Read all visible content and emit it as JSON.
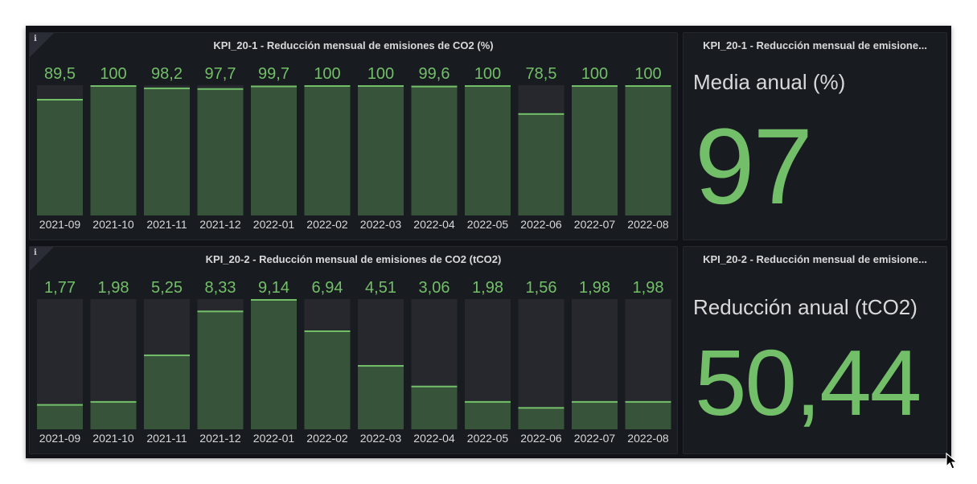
{
  "colors": {
    "accent_green": "#73bf69",
    "bar_fill": "#37543a",
    "bar_track": "#26282e",
    "panel_bg": "#181b1f",
    "dashboard_bg": "#111217",
    "text": "#d8d9da"
  },
  "panels": {
    "kpi1_bars": {
      "title": "KPI_20-1 - Reducción mensual de emisiones de CO2 (%)",
      "info_icon": "info-icon"
    },
    "kpi1_stat": {
      "title": "KPI_20-1 - Reducción mensual de emisione...",
      "label": "Media anual (%)",
      "value": "97"
    },
    "kpi2_bars": {
      "title": "KPI_20-2 - Reducción mensual de emisiones de CO2 (tCO2)",
      "info_icon": "info-icon"
    },
    "kpi2_stat": {
      "title": "KPI_20-2 - Reducción mensual de emisione...",
      "label": "Reducción anual (tCO2)",
      "value": "50,44"
    }
  },
  "chart_data": [
    {
      "type": "bar",
      "categories": [
        "2021-09",
        "2021-10",
        "2021-11",
        "2021-12",
        "2022-01",
        "2022-02",
        "2022-03",
        "2022-04",
        "2022-05",
        "2022-06",
        "2022-07",
        "2022-08"
      ],
      "values": [
        89.5,
        100,
        98.2,
        97.7,
        99.7,
        100,
        100,
        99.6,
        100,
        78.5,
        100,
        100
      ],
      "value_labels": [
        "89,5",
        "100",
        "98,2",
        "97,7",
        "99,7",
        "100",
        "100",
        "99,6",
        "100",
        "78,5",
        "100",
        "100"
      ],
      "ylim": [
        0,
        100
      ]
    },
    {
      "type": "bar",
      "categories": [
        "2021-09",
        "2021-10",
        "2021-11",
        "2021-12",
        "2022-01",
        "2022-02",
        "2022-03",
        "2022-04",
        "2022-05",
        "2022-06",
        "2022-07",
        "2022-08"
      ],
      "values": [
        1.77,
        1.98,
        5.25,
        8.33,
        9.14,
        6.94,
        4.51,
        3.06,
        1.98,
        1.56,
        1.98,
        1.98
      ],
      "value_labels": [
        "1,77",
        "1,98",
        "5,25",
        "8,33",
        "9,14",
        "6,94",
        "4,51",
        "3,06",
        "1,98",
        "1,56",
        "1,98",
        "1,98"
      ],
      "ylim": [
        0,
        9.14
      ]
    }
  ]
}
